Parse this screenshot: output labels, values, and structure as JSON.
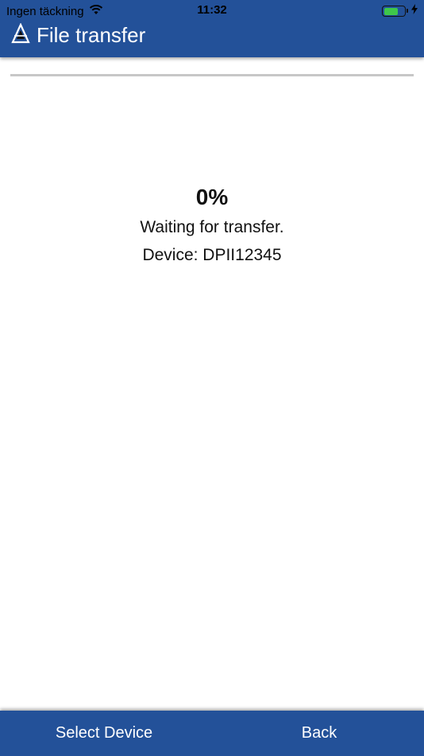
{
  "status_bar": {
    "carrier": "Ingen täckning",
    "time": "11:32",
    "battery_level_fraction": 0.7
  },
  "header": {
    "title": "File transfer",
    "logo_icon": "triangle-logo-icon"
  },
  "transfer": {
    "progress_fraction": 0.0,
    "percent_label": "0%",
    "status_message": "Waiting for transfer.",
    "device_line": "Device: DPII12345"
  },
  "bottom_bar": {
    "select_device_label": "Select Device",
    "back_label": "Back"
  },
  "colors": {
    "primary": "#235199",
    "progress_track": "#c7c7c7",
    "battery": "#3ec74a"
  }
}
